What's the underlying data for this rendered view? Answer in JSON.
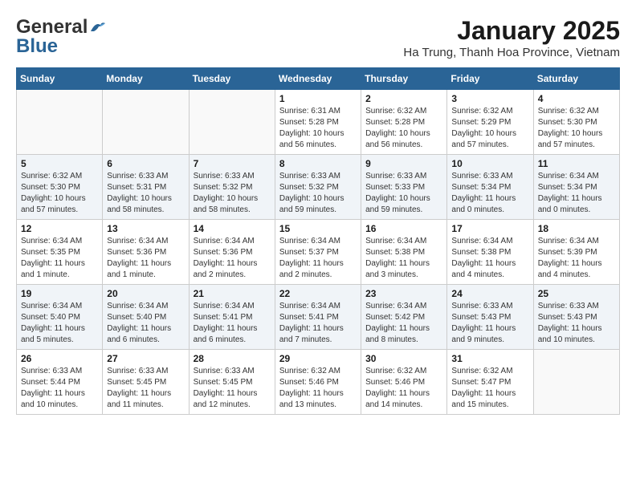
{
  "logo": {
    "general": "General",
    "blue": "Blue"
  },
  "title": "January 2025",
  "subtitle": "Ha Trung, Thanh Hoa Province, Vietnam",
  "days_of_week": [
    "Sunday",
    "Monday",
    "Tuesday",
    "Wednesday",
    "Thursday",
    "Friday",
    "Saturday"
  ],
  "weeks": [
    {
      "days": [
        {
          "num": "",
          "info": ""
        },
        {
          "num": "",
          "info": ""
        },
        {
          "num": "",
          "info": ""
        },
        {
          "num": "1",
          "info": "Sunrise: 6:31 AM\nSunset: 5:28 PM\nDaylight: 10 hours\nand 56 minutes."
        },
        {
          "num": "2",
          "info": "Sunrise: 6:32 AM\nSunset: 5:28 PM\nDaylight: 10 hours\nand 56 minutes."
        },
        {
          "num": "3",
          "info": "Sunrise: 6:32 AM\nSunset: 5:29 PM\nDaylight: 10 hours\nand 57 minutes."
        },
        {
          "num": "4",
          "info": "Sunrise: 6:32 AM\nSunset: 5:30 PM\nDaylight: 10 hours\nand 57 minutes."
        }
      ]
    },
    {
      "days": [
        {
          "num": "5",
          "info": "Sunrise: 6:32 AM\nSunset: 5:30 PM\nDaylight: 10 hours\nand 57 minutes."
        },
        {
          "num": "6",
          "info": "Sunrise: 6:33 AM\nSunset: 5:31 PM\nDaylight: 10 hours\nand 58 minutes."
        },
        {
          "num": "7",
          "info": "Sunrise: 6:33 AM\nSunset: 5:32 PM\nDaylight: 10 hours\nand 58 minutes."
        },
        {
          "num": "8",
          "info": "Sunrise: 6:33 AM\nSunset: 5:32 PM\nDaylight: 10 hours\nand 59 minutes."
        },
        {
          "num": "9",
          "info": "Sunrise: 6:33 AM\nSunset: 5:33 PM\nDaylight: 10 hours\nand 59 minutes."
        },
        {
          "num": "10",
          "info": "Sunrise: 6:33 AM\nSunset: 5:34 PM\nDaylight: 11 hours\nand 0 minutes."
        },
        {
          "num": "11",
          "info": "Sunrise: 6:34 AM\nSunset: 5:34 PM\nDaylight: 11 hours\nand 0 minutes."
        }
      ]
    },
    {
      "days": [
        {
          "num": "12",
          "info": "Sunrise: 6:34 AM\nSunset: 5:35 PM\nDaylight: 11 hours\nand 1 minute."
        },
        {
          "num": "13",
          "info": "Sunrise: 6:34 AM\nSunset: 5:36 PM\nDaylight: 11 hours\nand 1 minute."
        },
        {
          "num": "14",
          "info": "Sunrise: 6:34 AM\nSunset: 5:36 PM\nDaylight: 11 hours\nand 2 minutes."
        },
        {
          "num": "15",
          "info": "Sunrise: 6:34 AM\nSunset: 5:37 PM\nDaylight: 11 hours\nand 2 minutes."
        },
        {
          "num": "16",
          "info": "Sunrise: 6:34 AM\nSunset: 5:38 PM\nDaylight: 11 hours\nand 3 minutes."
        },
        {
          "num": "17",
          "info": "Sunrise: 6:34 AM\nSunset: 5:38 PM\nDaylight: 11 hours\nand 4 minutes."
        },
        {
          "num": "18",
          "info": "Sunrise: 6:34 AM\nSunset: 5:39 PM\nDaylight: 11 hours\nand 4 minutes."
        }
      ]
    },
    {
      "days": [
        {
          "num": "19",
          "info": "Sunrise: 6:34 AM\nSunset: 5:40 PM\nDaylight: 11 hours\nand 5 minutes."
        },
        {
          "num": "20",
          "info": "Sunrise: 6:34 AM\nSunset: 5:40 PM\nDaylight: 11 hours\nand 6 minutes."
        },
        {
          "num": "21",
          "info": "Sunrise: 6:34 AM\nSunset: 5:41 PM\nDaylight: 11 hours\nand 6 minutes."
        },
        {
          "num": "22",
          "info": "Sunrise: 6:34 AM\nSunset: 5:41 PM\nDaylight: 11 hours\nand 7 minutes."
        },
        {
          "num": "23",
          "info": "Sunrise: 6:34 AM\nSunset: 5:42 PM\nDaylight: 11 hours\nand 8 minutes."
        },
        {
          "num": "24",
          "info": "Sunrise: 6:33 AM\nSunset: 5:43 PM\nDaylight: 11 hours\nand 9 minutes."
        },
        {
          "num": "25",
          "info": "Sunrise: 6:33 AM\nSunset: 5:43 PM\nDaylight: 11 hours\nand 10 minutes."
        }
      ]
    },
    {
      "days": [
        {
          "num": "26",
          "info": "Sunrise: 6:33 AM\nSunset: 5:44 PM\nDaylight: 11 hours\nand 10 minutes."
        },
        {
          "num": "27",
          "info": "Sunrise: 6:33 AM\nSunset: 5:45 PM\nDaylight: 11 hours\nand 11 minutes."
        },
        {
          "num": "28",
          "info": "Sunrise: 6:33 AM\nSunset: 5:45 PM\nDaylight: 11 hours\nand 12 minutes."
        },
        {
          "num": "29",
          "info": "Sunrise: 6:32 AM\nSunset: 5:46 PM\nDaylight: 11 hours\nand 13 minutes."
        },
        {
          "num": "30",
          "info": "Sunrise: 6:32 AM\nSunset: 5:46 PM\nDaylight: 11 hours\nand 14 minutes."
        },
        {
          "num": "31",
          "info": "Sunrise: 6:32 AM\nSunset: 5:47 PM\nDaylight: 11 hours\nand 15 minutes."
        },
        {
          "num": "",
          "info": ""
        }
      ]
    }
  ]
}
